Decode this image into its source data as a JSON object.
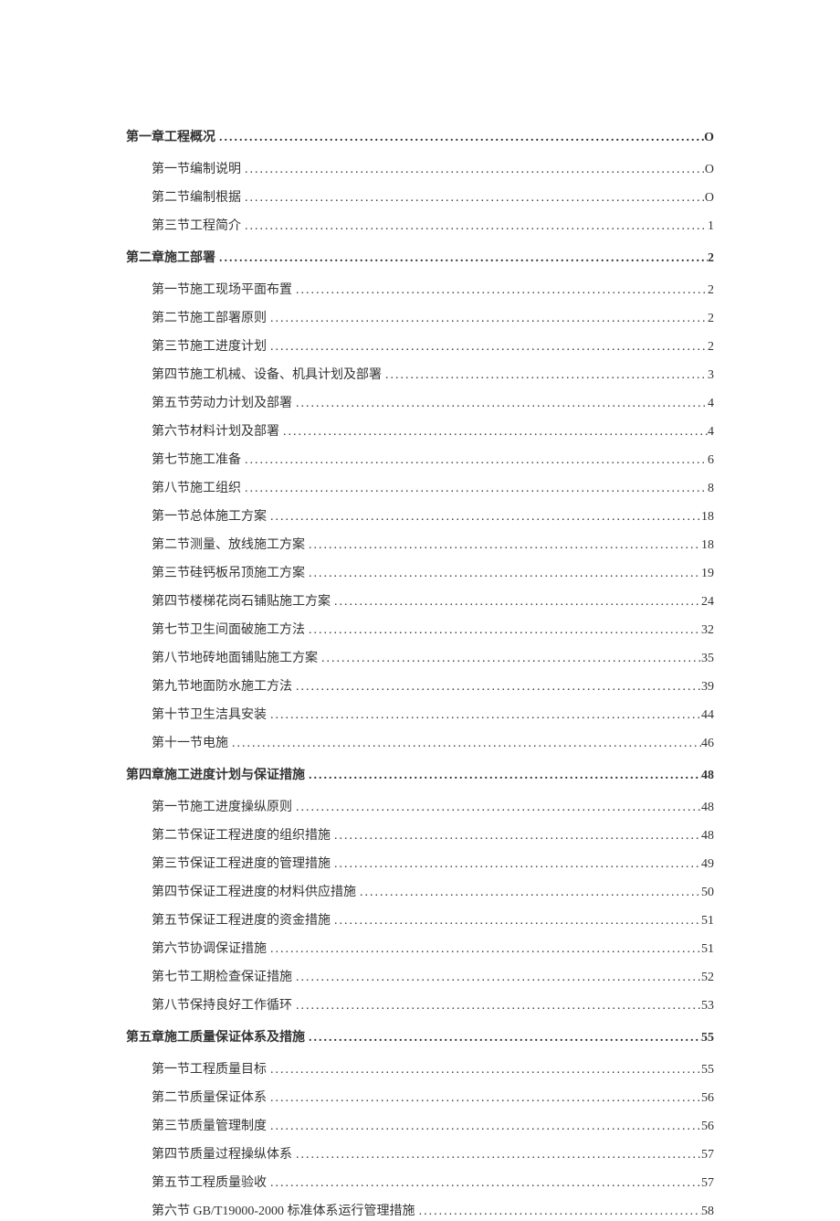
{
  "entries": [
    {
      "level": "chapter",
      "title": "第一章工程概况",
      "page": "O"
    },
    {
      "level": "section",
      "title": "第一节编制说明",
      "page": "O"
    },
    {
      "level": "section",
      "title": "第二节编制根据",
      "page": "O"
    },
    {
      "level": "section",
      "title": "第三节工程简介",
      "page": "1"
    },
    {
      "level": "chapter",
      "title": "第二章施工部署",
      "page": "2"
    },
    {
      "level": "section",
      "title": "第一节施工现场平面布置",
      "page": "2"
    },
    {
      "level": "section",
      "title": "第二节施工部署原则",
      "page": "2"
    },
    {
      "level": "section",
      "title": "第三节施工进度计划",
      "page": "2"
    },
    {
      "level": "section",
      "title": "第四节施工机械、设备、机具计划及部署",
      "page": "3"
    },
    {
      "level": "section",
      "title": "第五节劳动力计划及部署",
      "page": "4"
    },
    {
      "level": "section",
      "title": "第六节材料计划及部署",
      "page": "4"
    },
    {
      "level": "section",
      "title": "第七节施工准备",
      "page": "6"
    },
    {
      "level": "section",
      "title": "第八节施工组织",
      "page": "8"
    },
    {
      "level": "section",
      "title": "第一节总体施工方案",
      "page": "18"
    },
    {
      "level": "section",
      "title": "第二节测量、放线施工方案",
      "page": "18"
    },
    {
      "level": "section",
      "title": "第三节硅钙板吊顶施工方案",
      "page": "19"
    },
    {
      "level": "section",
      "title": "第四节楼梯花岗石铺贴施工方案",
      "page": "24"
    },
    {
      "level": "section",
      "title": "第七节卫生间面破施工方法",
      "page": "32"
    },
    {
      "level": "section",
      "title": "第八节地砖地面铺贴施工方案",
      "page": "35"
    },
    {
      "level": "section",
      "title": "第九节地面防水施工方法",
      "page": "39"
    },
    {
      "level": "section",
      "title": "第十节卫生洁具安装",
      "page": "44"
    },
    {
      "level": "section",
      "title": "第十一节电施",
      "page": "46"
    },
    {
      "level": "chapter",
      "title": "第四章施工进度计划与保证措施",
      "page": "48"
    },
    {
      "level": "section",
      "title": "第一节施工进度操纵原则",
      "page": "48"
    },
    {
      "level": "section",
      "title": "第二节保证工程进度的组织措施",
      "page": "48"
    },
    {
      "level": "section",
      "title": "第三节保证工程进度的管理措施",
      "page": "49"
    },
    {
      "level": "section",
      "title": "第四节保证工程进度的材料供应措施",
      "page": "50"
    },
    {
      "level": "section",
      "title": "第五节保证工程进度的资金措施",
      "page": "51"
    },
    {
      "level": "section",
      "title": "第六节协调保证措施",
      "page": "51"
    },
    {
      "level": "section",
      "title": "第七节工期检查保证措施",
      "page": "52"
    },
    {
      "level": "section",
      "title": "第八节保持良好工作循环",
      "page": "53"
    },
    {
      "level": "chapter",
      "title": "第五章施工质量保证体系及措施",
      "page": "55"
    },
    {
      "level": "section",
      "title": "第一节工程质量目标",
      "page": "55"
    },
    {
      "level": "section",
      "title": "第二节质量保证体系",
      "page": "56"
    },
    {
      "level": "section",
      "title": "第三节质量管理制度",
      "page": "56"
    },
    {
      "level": "section",
      "title": "第四节质量过程操纵体系",
      "page": "57"
    },
    {
      "level": "section",
      "title": "第五节工程质量验收",
      "page": "57"
    },
    {
      "level": "section",
      "title": "第六节 GB/T19000-2000 标准体系运行管理措施",
      "page": "58"
    }
  ]
}
